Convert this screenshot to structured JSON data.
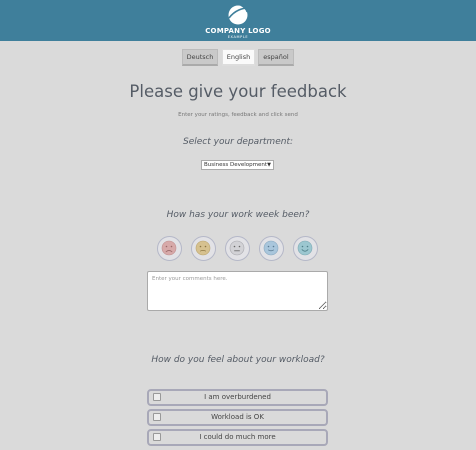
{
  "header": {
    "logo_text": "COMPANY LOGO",
    "logo_sub": "EXAMPLE",
    "bg_color": "#3f7f9b"
  },
  "languages": [
    {
      "label": "Deutsch",
      "active": false
    },
    {
      "label": "English",
      "active": true
    },
    {
      "label": "español",
      "active": false
    }
  ],
  "main": {
    "title": "Please give your feedback",
    "subtitle": "Enter your ratings, feedback and click send",
    "department_label": "Select your department:",
    "department_selected": "Business Development",
    "week_question": "How has your work week been?",
    "moods": [
      {
        "icon": "very-sad-face-icon",
        "color": "#d7a9a9"
      },
      {
        "icon": "sad-face-icon",
        "color": "#d6c18f"
      },
      {
        "icon": "neutral-face-icon",
        "color": "#c8c8cc"
      },
      {
        "icon": "happy-face-icon",
        "color": "#a9c6dc"
      },
      {
        "icon": "very-happy-face-icon",
        "color": "#9cc7d0"
      }
    ],
    "comments_placeholder": "Enter your comments here.",
    "workload_question": "How do you feel about your workload?",
    "workload_options": [
      {
        "label": "I am overburdened"
      },
      {
        "label": "Workload is OK"
      },
      {
        "label": "I could do much more"
      }
    ]
  }
}
